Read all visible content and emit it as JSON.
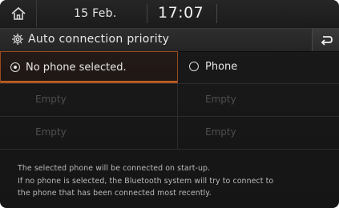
{
  "status_bar": {
    "date": "15 Feb.",
    "time": "17:07"
  },
  "title_bar": {
    "title": "Auto connection priority"
  },
  "options": {
    "row1": {
      "left": {
        "label": "No phone selected.",
        "selected": true
      },
      "right": {
        "label": "Phone",
        "selected": false
      }
    },
    "row2": {
      "left": "Empty",
      "right": "Empty"
    },
    "row3": {
      "left": "Empty",
      "right": "Empty"
    }
  },
  "info": {
    "line1": "The selected phone will be connected on start-up.",
    "line2": "If no phone is selected, the Bluetooth system will try to connect to",
    "line3": "the phone that has been connected most recently."
  },
  "colors": {
    "background": "#151515",
    "selected_border": "#9a4a20",
    "text": "#e6e6e6",
    "disabled_text": "#4f4f4f"
  },
  "icons": [
    "home-icon",
    "gear-icon",
    "back-icon",
    "radio-icon"
  ]
}
